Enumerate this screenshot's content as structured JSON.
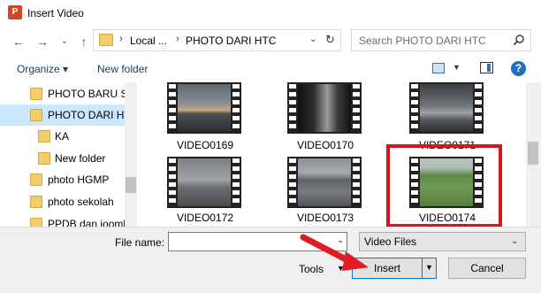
{
  "window": {
    "title": "Insert Video",
    "app_icon": "P"
  },
  "address": {
    "crumbs": [
      "Local ...",
      "PHOTO DARI HTC"
    ],
    "separator": "›"
  },
  "search": {
    "placeholder": "Search PHOTO DARI HTC"
  },
  "toolbar": {
    "organize": "Organize ▾",
    "new_folder": "New folder"
  },
  "nav": {
    "items": [
      {
        "label": "PHOTO BARU SE"
      },
      {
        "label": "PHOTO DARI HTC",
        "selected": true
      },
      {
        "label": "KA"
      },
      {
        "label": "New folder"
      },
      {
        "label": "photo HGMP"
      },
      {
        "label": "photo sekolah"
      },
      {
        "label": "PPDB dan joomla"
      }
    ]
  },
  "files": [
    {
      "name": "VIDEO0169",
      "scene": "sunset-beach"
    },
    {
      "name": "VIDEO0170",
      "scene": "dark-room"
    },
    {
      "name": "VIDEO0171",
      "scene": "cloudy-sea"
    },
    {
      "name": "VIDEO0172",
      "scene": "grey-beach"
    },
    {
      "name": "VIDEO0173",
      "scene": "grey-sea"
    },
    {
      "name": "VIDEO0174",
      "scene": "green-field",
      "selected": true
    }
  ],
  "bottom": {
    "file_name_label": "File name:",
    "file_name_value": "",
    "filter": "Video Files",
    "tools": "Tools",
    "insert": "Insert",
    "cancel": "Cancel"
  },
  "colors": {
    "selection_box": "#d9141e",
    "accent": "#0078d7",
    "nav_selected": "#cce8ff"
  }
}
